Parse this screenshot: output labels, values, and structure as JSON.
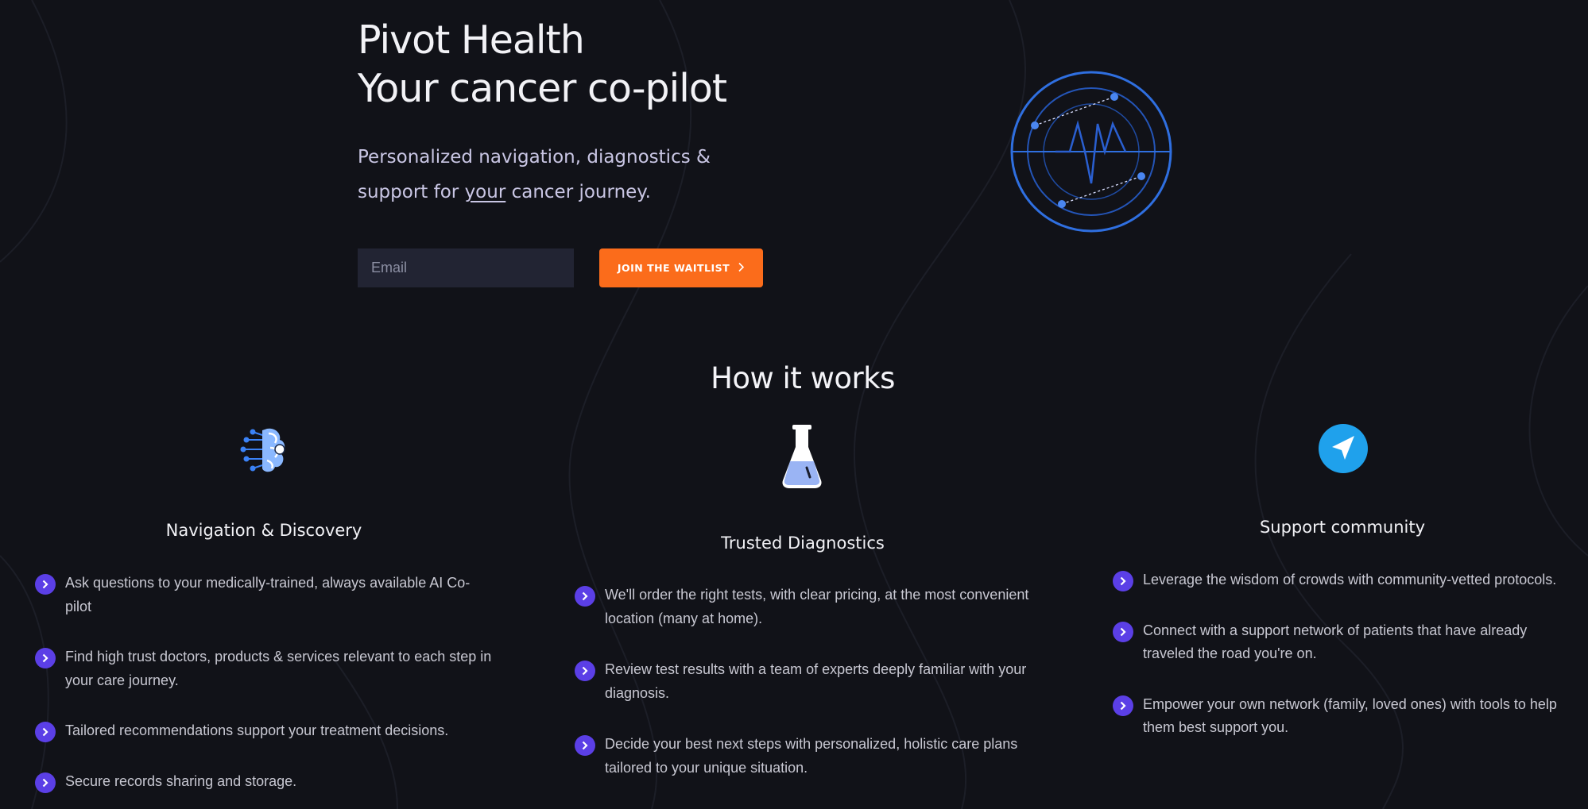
{
  "hero": {
    "title_line1": "Pivot Health",
    "title_line2": "Your cancer co-pilot",
    "subtitle_before": "Personalized navigation, diagnostics & support for ",
    "subtitle_emphasis": "your",
    "subtitle_after": " cancer journey.",
    "email_placeholder": "Email",
    "cta_label": "JOIN THE WAITLIST",
    "cta_icon": "chevron-right-icon",
    "logo_icon": "radar-pulse-logo"
  },
  "how_it_works": {
    "title": "How it works",
    "columns": [
      {
        "icon": "ai-brain-icon",
        "title": "Navigation & Discovery",
        "items": [
          "Ask questions to your medically-trained, always available AI Co-pilot",
          "Find high trust doctors, products & services relevant to each step in your care journey.",
          "Tailored recommendations support your treatment decisions.",
          "Secure records sharing and storage."
        ]
      },
      {
        "icon": "flask-icon",
        "title": "Trusted Diagnostics",
        "items": [
          "We'll order the right tests, with clear pricing, at the most convenient location (many at home).",
          "Review test results with a team of experts deeply familiar with your diagnosis.",
          "Decide your best next steps with personalized, holistic care plans tailored to your unique situation."
        ]
      },
      {
        "icon": "navigation-arrow-icon",
        "title": "Support community",
        "items": [
          "Leverage the wisdom of crowds with community-vetted protocols.",
          "Connect with a support network of patients that have already traveled the road you're on.",
          "Empower your own network (family, loved ones) with tools to help them best support you."
        ]
      }
    ]
  },
  "colors": {
    "background": "#111218",
    "accent_orange": "#fb6c1b",
    "bullet_purple": "#5b3fe6",
    "logo_blue": "#2f6fe0"
  }
}
